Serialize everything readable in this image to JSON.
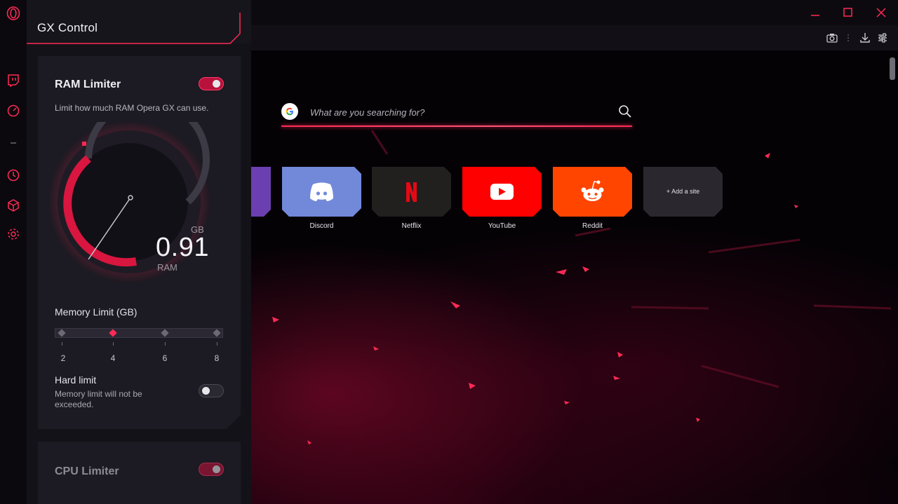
{
  "panel": {
    "title": "GX Control"
  },
  "ram": {
    "title": "RAM Limiter",
    "enabled": true,
    "description": "Limit how much RAM Opera GX can use.",
    "gauge": {
      "unit": "GB",
      "value": "0.91",
      "label": "RAM"
    },
    "memory_limit_label": "Memory Limit (GB)",
    "slider_ticks": [
      "2",
      "4",
      "6",
      "8"
    ],
    "slider_selected": "4",
    "hard_limit": {
      "title": "Hard limit",
      "description": "Memory limit will not be exceeded.",
      "enabled": false
    }
  },
  "cpu": {
    "title": "CPU Limiter",
    "enabled": true
  },
  "search": {
    "placeholder": "What are you searching for?"
  },
  "speed_dials": [
    {
      "label": "Discord",
      "color": "#7289da"
    },
    {
      "label": "Netflix",
      "color": "#221f1f"
    },
    {
      "label": "YouTube",
      "color": "#ff0000"
    },
    {
      "label": "Reddit",
      "color": "#ff4500"
    }
  ],
  "add_site": {
    "label": "+ Add a site"
  },
  "colors": {
    "accent": "#ff2a55",
    "panel_bg": "#141219",
    "card_bg": "#1c1a22"
  },
  "icons": {
    "sidebar": [
      "opera-gx-logo-icon",
      "twitch-icon",
      "speed-gauge-icon",
      "divider-icon",
      "history-clock-icon",
      "extensions-cube-icon",
      "settings-gear-icon"
    ],
    "toolbar": [
      "camera-icon",
      "download-icon",
      "easy-setup-sliders-icon"
    ],
    "window": [
      "minimize-icon",
      "maximize-icon",
      "close-icon"
    ]
  }
}
